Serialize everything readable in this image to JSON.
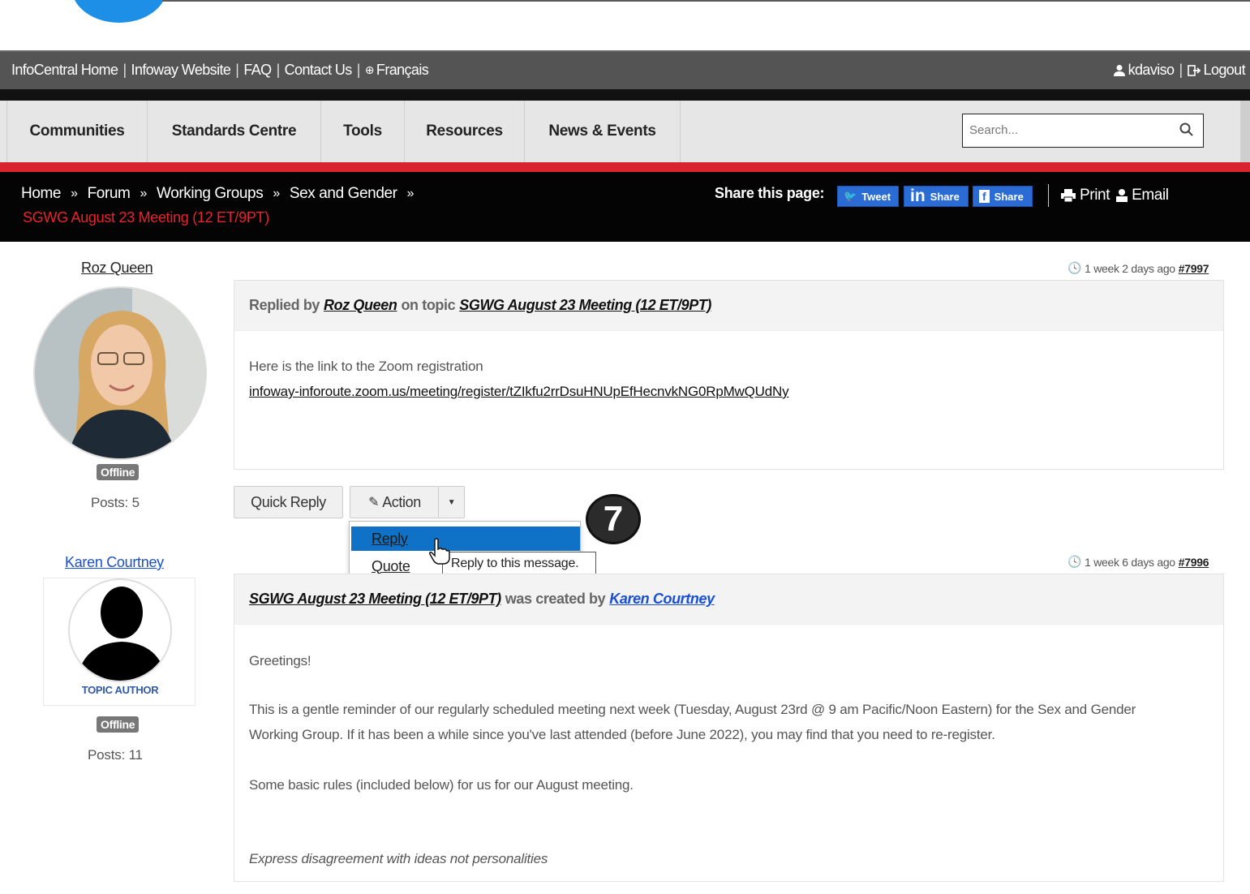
{
  "utility_bar": {
    "links": [
      "InfoCentral Home",
      "Infoway Website",
      "FAQ",
      "Contact Us",
      "Français"
    ],
    "user": "kdaviso",
    "logout": "Logout"
  },
  "nav": {
    "items": [
      "Communities",
      "Standards Centre",
      "Tools",
      "Resources",
      "News & Events"
    ],
    "search_placeholder": "Search..."
  },
  "breadcrumb": {
    "items": [
      "Home",
      "Forum",
      "Working Groups",
      "Sex and Gender"
    ],
    "current": "SGWG August 23 Meeting (12 ET/9PT)"
  },
  "share": {
    "label": "Share this page:",
    "tweet": "Tweet",
    "linkedin": "Share",
    "facebook": "Share",
    "print": "Print",
    "email": "Email"
  },
  "posts": [
    {
      "author": "Roz Queen",
      "status": "Offline",
      "posts_label": "Posts: 5",
      "time": "1 week 2 days ago",
      "id": "#7997",
      "header_prefix": "Replied by",
      "header_mid": "on topic",
      "topic": "SGWG August 23 Meeting (12 ET/9PT)",
      "body_line1": "Here is the link to the Zoom registration",
      "body_link": "infoway-inforoute.zoom.us/meeting/register/tZIkfu2rrDsuHNUpEfHecnvkNG0RpMwQUdNy"
    },
    {
      "author": "Karen Courtney",
      "role": "TOPIC AUTHOR",
      "status": "Offline",
      "posts_label": "Posts: 11",
      "time": "1 week 6 days ago",
      "id": "#7996",
      "topic": "SGWG August 23 Meeting (12 ET/9PT)",
      "header_mid": "was created by",
      "body_greeting": "Greetings!",
      "body_p1_line1": "This is a gentle reminder of our regularly scheduled meeting next week (Tuesday, August 23rd @ 9 am Pacific/Noon Eastern) for the Sex and Gender",
      "body_p1_line2": "Working Group. If it has been a while since you've last attended (before June 2022), you may find that you need to re-register.",
      "body_p2": "Some basic rules (included below) for us for our August meeting.",
      "body_rule1": "Express disagreement with ideas not personalities"
    }
  ],
  "actions": {
    "quick_reply": "Quick Reply",
    "action": "Action",
    "menu": [
      "Reply",
      "Quote"
    ],
    "tooltip": "Reply to this message."
  },
  "step_marker": "7",
  "colors": {
    "utility_bar": "#545454",
    "accent_red": "#d8242e",
    "breadcrumb_bg": "#040404",
    "current_crumb": "#e8232a",
    "menu_highlight": "#0f72c6",
    "share_blue": "#2a6cd4"
  }
}
